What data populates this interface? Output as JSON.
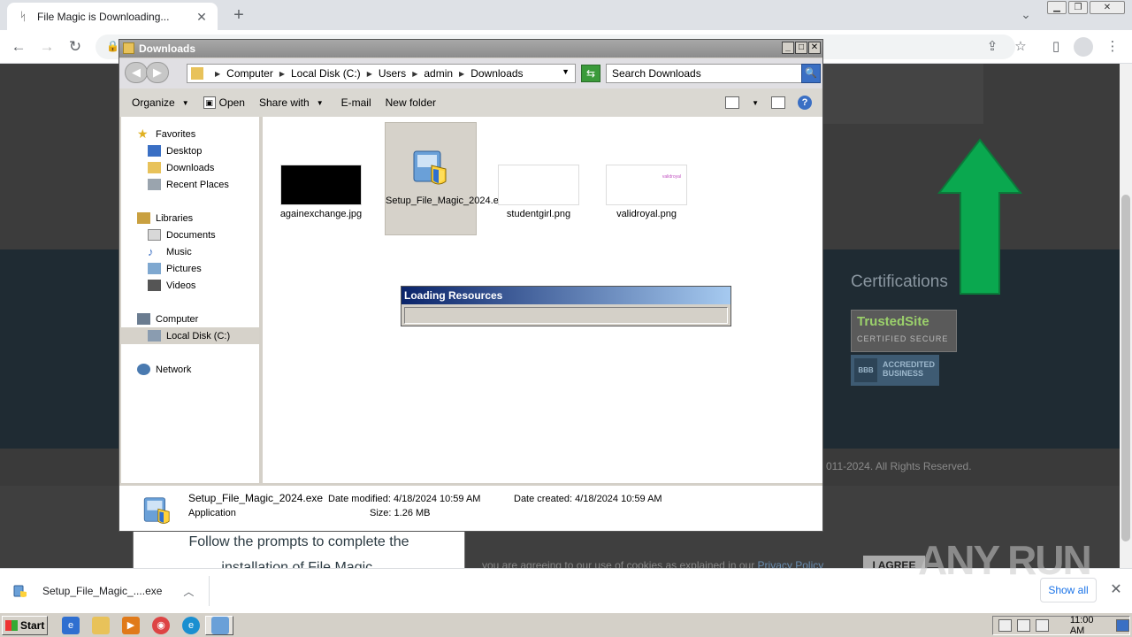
{
  "browser": {
    "tab_title": "File Magic is Downloading...",
    "tab_close": "✕",
    "new_tab": "+",
    "tab_search": "⌄"
  },
  "webpage": {
    "certifications_title": "Certifications",
    "trustedsite_label": "TrustedSite",
    "trustedsite_sub": "CERTIFIED SECURE",
    "bbb_logo": "BBB",
    "bbb_label_1": "ACCREDITED",
    "bbb_label_2": "BUSINESS",
    "copyright": "011-2024. All Rights Reserved.",
    "install_line_1": "Follow the prompts to complete the",
    "install_line_2": "installation of File Magic.",
    "cookie_text": "you are agreeing to our use of cookies as explained in our",
    "privacy_link": "Privacy Policy",
    "agree_button": "I AGREE"
  },
  "explorer": {
    "title": "Downloads",
    "caption_min": "_",
    "caption_max": "□",
    "caption_close": "✕",
    "breadcrumbs": [
      "Computer",
      "Local Disk (C:)",
      "Users",
      "admin",
      "Downloads"
    ],
    "search_placeholder": "Search Downloads",
    "commands": {
      "organize": "Organize",
      "open": "Open",
      "share_with": "Share with",
      "email": "E-mail",
      "new_folder": "New folder"
    },
    "nav": {
      "favorites": "Favorites",
      "desktop": "Desktop",
      "downloads": "Downloads",
      "recent_places": "Recent Places",
      "libraries": "Libraries",
      "documents": "Documents",
      "music": "Music",
      "pictures": "Pictures",
      "videos": "Videos",
      "computer": "Computer",
      "local_disk": "Local Disk (C:)",
      "network": "Network"
    },
    "files": [
      {
        "name": "againexchange.jpg"
      },
      {
        "name": "Setup_File_Magic_2024.exe"
      },
      {
        "name": "studentgirl.png"
      },
      {
        "name": "validroyal.png",
        "thumb_text": "validroyal"
      }
    ],
    "loading_title": "Loading Resources",
    "details": {
      "filename": "Setup_File_Magic_2024.exe",
      "type": "Application",
      "date_modified_label": "Date modified:",
      "date_modified": "4/18/2024 10:59 AM",
      "size_label": "Size:",
      "size": "1.26 MB",
      "date_created_label": "Date created:",
      "date_created": "4/18/2024 10:59 AM"
    }
  },
  "download_bar": {
    "filename": "Setup_File_Magic_....exe",
    "show_all": "Show all",
    "close": "✕"
  },
  "watermark": "ANY RUN",
  "taskbar": {
    "start_label": "Start",
    "clock": "11:00 AM"
  }
}
